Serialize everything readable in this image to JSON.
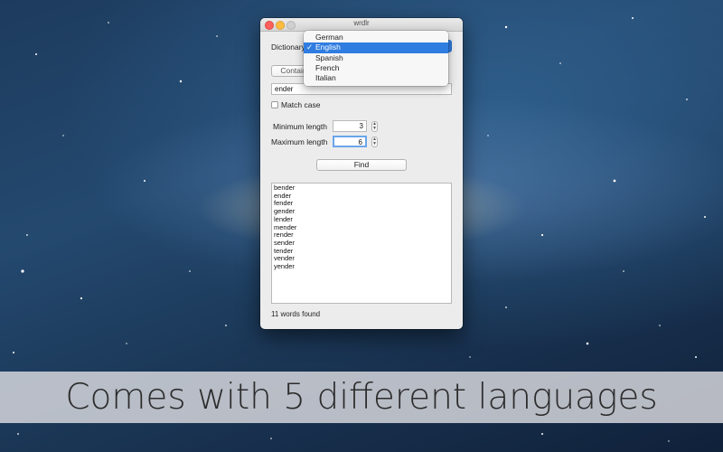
{
  "window": {
    "title": "wrdlr"
  },
  "form": {
    "dictionary_label": "Dictionary",
    "mode_button": "Contain",
    "search_value": "ender",
    "match_case_label": "Match case",
    "min_length_label": "Minimum length",
    "min_length_value": "3",
    "max_length_label": "Maximum length",
    "max_length_value": "6",
    "find_label": "Find"
  },
  "dropdown": {
    "options": [
      "German",
      "English",
      "Spanish",
      "French",
      "Italian"
    ],
    "selected": "English",
    "check_glyph": "✓"
  },
  "results": {
    "words": [
      "bender",
      "ender",
      "fender",
      "gender",
      "lender",
      "mender",
      "render",
      "sender",
      "tender",
      "vender",
      "yender"
    ],
    "status": "11 words found"
  },
  "banner": {
    "text": "Comes with 5 different languages"
  },
  "colors": {
    "accent": "#2f7de1",
    "banner_bg": "#dcdce1"
  }
}
